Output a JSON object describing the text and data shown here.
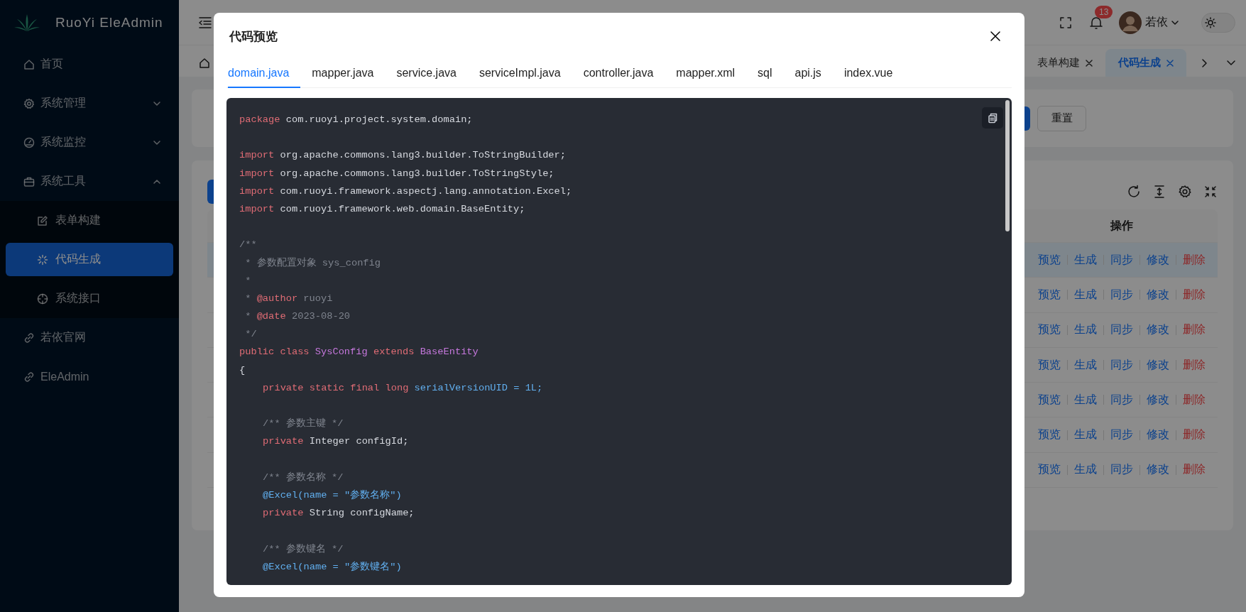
{
  "sidebar": {
    "logo_text": "RuoYi EleAdmin",
    "items": [
      {
        "label": "首页",
        "selected": false
      },
      {
        "label": "系统管理",
        "selected": false,
        "expanded": false
      },
      {
        "label": "系统监控",
        "selected": false,
        "expanded": false
      },
      {
        "label": "系统工具",
        "selected": false,
        "expanded": true,
        "children": [
          {
            "label": "表单构建",
            "selected": false
          },
          {
            "label": "代码生成",
            "selected": true
          },
          {
            "label": "系统接口",
            "selected": false
          }
        ]
      },
      {
        "label": "若依官网",
        "selected": false
      },
      {
        "label": "EleAdmin",
        "selected": false
      }
    ]
  },
  "header": {
    "notification_count": "13",
    "user_name": "若依",
    "dark_mode": false
  },
  "page_tabs": [
    {
      "label": "表单构建",
      "selected": false
    },
    {
      "label": "代码生成",
      "selected": true
    }
  ],
  "search_card": {
    "reset_button": "重置"
  },
  "table": {
    "column_header": "操作",
    "rows": [
      {
        "highlighted": true,
        "actions": [
          {
            "label": "预览",
            "kind": "link"
          },
          {
            "label": "生成",
            "kind": "link"
          },
          {
            "label": "同步",
            "kind": "link"
          },
          {
            "label": "修改",
            "kind": "link"
          },
          {
            "label": "删除",
            "kind": "danger"
          }
        ]
      },
      {
        "highlighted": false,
        "actions": [
          {
            "label": "预览",
            "kind": "link"
          },
          {
            "label": "生成",
            "kind": "link"
          },
          {
            "label": "同步",
            "kind": "link"
          },
          {
            "label": "修改",
            "kind": "link"
          },
          {
            "label": "删除",
            "kind": "danger"
          }
        ]
      },
      {
        "highlighted": false,
        "actions": [
          {
            "label": "预览",
            "kind": "link"
          },
          {
            "label": "生成",
            "kind": "link"
          },
          {
            "label": "同步",
            "kind": "link"
          },
          {
            "label": "修改",
            "kind": "link"
          },
          {
            "label": "删除",
            "kind": "danger"
          }
        ]
      },
      {
        "highlighted": false,
        "actions": [
          {
            "label": "预览",
            "kind": "link"
          },
          {
            "label": "生成",
            "kind": "link"
          },
          {
            "label": "同步",
            "kind": "link"
          },
          {
            "label": "修改",
            "kind": "link"
          },
          {
            "label": "删除",
            "kind": "danger"
          }
        ]
      },
      {
        "highlighted": false,
        "actions": [
          {
            "label": "预览",
            "kind": "link"
          },
          {
            "label": "生成",
            "kind": "link"
          },
          {
            "label": "同步",
            "kind": "link"
          },
          {
            "label": "修改",
            "kind": "link"
          },
          {
            "label": "删除",
            "kind": "danger"
          }
        ]
      },
      {
        "highlighted": false,
        "actions": [
          {
            "label": "预览",
            "kind": "link"
          },
          {
            "label": "生成",
            "kind": "link"
          },
          {
            "label": "同步",
            "kind": "link"
          },
          {
            "label": "修改",
            "kind": "link"
          },
          {
            "label": "删除",
            "kind": "danger"
          }
        ]
      },
      {
        "highlighted": false,
        "actions": [
          {
            "label": "预览",
            "kind": "link"
          },
          {
            "label": "生成",
            "kind": "link"
          },
          {
            "label": "同步",
            "kind": "link"
          },
          {
            "label": "修改",
            "kind": "link"
          },
          {
            "label": "删除",
            "kind": "danger"
          }
        ]
      }
    ]
  },
  "dialog": {
    "title": "代码预览",
    "tabs": [
      {
        "label": "domain.java",
        "selected": true
      },
      {
        "label": "mapper.java",
        "selected": false
      },
      {
        "label": "service.java",
        "selected": false
      },
      {
        "label": "serviceImpl.java",
        "selected": false
      },
      {
        "label": "controller.java",
        "selected": false
      },
      {
        "label": "mapper.xml",
        "selected": false
      },
      {
        "label": "sql",
        "selected": false
      },
      {
        "label": "api.js",
        "selected": false
      },
      {
        "label": "index.vue",
        "selected": false
      }
    ],
    "code_lines": [
      {
        "kind": "code",
        "tokens": [
          {
            "kind": "keyword",
            "text": "package"
          },
          {
            "kind": "plain",
            "text": " com.ruoyi.project.system.domain;"
          }
        ]
      },
      {
        "kind": "blank"
      },
      {
        "kind": "code",
        "tokens": [
          {
            "kind": "keyword",
            "text": "import"
          },
          {
            "kind": "plain",
            "text": " org.apache.commons.lang3.builder.ToStringBuilder;"
          }
        ]
      },
      {
        "kind": "code",
        "tokens": [
          {
            "kind": "keyword",
            "text": "import"
          },
          {
            "kind": "plain",
            "text": " org.apache.commons.lang3.builder.ToStringStyle;"
          }
        ]
      },
      {
        "kind": "code",
        "tokens": [
          {
            "kind": "keyword",
            "text": "import"
          },
          {
            "kind": "plain",
            "text": " com.ruoyi.framework.aspectj.lang.annotation.Excel;"
          }
        ]
      },
      {
        "kind": "code",
        "tokens": [
          {
            "kind": "keyword",
            "text": "import"
          },
          {
            "kind": "plain",
            "text": " com.ruoyi.framework.web.domain.BaseEntity;"
          }
        ]
      },
      {
        "kind": "blank"
      },
      {
        "kind": "code",
        "tokens": [
          {
            "kind": "comment",
            "text": "/**"
          }
        ]
      },
      {
        "kind": "code",
        "tokens": [
          {
            "kind": "comment",
            "text": " * 参数配置对象 sys_config"
          }
        ]
      },
      {
        "kind": "code",
        "tokens": [
          {
            "kind": "comment",
            "text": " *"
          }
        ]
      },
      {
        "kind": "code",
        "tokens": [
          {
            "kind": "comment",
            "text": " * "
          },
          {
            "kind": "doc_tag",
            "text": "@author"
          },
          {
            "kind": "comment",
            "text": " ruoyi"
          }
        ]
      },
      {
        "kind": "code",
        "tokens": [
          {
            "kind": "comment",
            "text": " * "
          },
          {
            "kind": "doc_tag",
            "text": "@date"
          },
          {
            "kind": "comment",
            "text": " 2023-08-20"
          }
        ]
      },
      {
        "kind": "code",
        "tokens": [
          {
            "kind": "comment",
            "text": " */"
          }
        ]
      },
      {
        "kind": "code",
        "tokens": [
          {
            "kind": "keyword",
            "text": "public class "
          },
          {
            "kind": "type",
            "text": "SysConfig"
          },
          {
            "kind": "keyword",
            "text": " extends "
          },
          {
            "kind": "type",
            "text": "BaseEntity"
          }
        ]
      },
      {
        "kind": "code",
        "tokens": [
          {
            "kind": "plain",
            "text": "{"
          }
        ]
      },
      {
        "kind": "code",
        "indented": true,
        "tokens": [
          {
            "kind": "keyword",
            "text": "private static final long "
          },
          {
            "kind": "attribute",
            "text": "serialVersionUID = 1L;"
          }
        ]
      },
      {
        "kind": "blank"
      },
      {
        "kind": "code",
        "indented": true,
        "tokens": [
          {
            "kind": "comment",
            "text": "/** 参数主键 */"
          }
        ]
      },
      {
        "kind": "code",
        "indented": true,
        "tokens": [
          {
            "kind": "keyword",
            "text": "private "
          },
          {
            "kind": "plain",
            "text": "Integer configId;"
          }
        ]
      },
      {
        "kind": "blank"
      },
      {
        "kind": "code",
        "indented": true,
        "tokens": [
          {
            "kind": "comment",
            "text": "/** 参数名称 */"
          }
        ]
      },
      {
        "kind": "code",
        "indented": true,
        "tokens": [
          {
            "kind": "attribute",
            "text": "@Excel(name = \"参数名称\")"
          }
        ]
      },
      {
        "kind": "code",
        "indented": true,
        "tokens": [
          {
            "kind": "keyword",
            "text": "private "
          },
          {
            "kind": "plain",
            "text": "String configName;"
          }
        ]
      },
      {
        "kind": "blank"
      },
      {
        "kind": "code",
        "indented": true,
        "tokens": [
          {
            "kind": "comment",
            "text": "/** 参数键名 */"
          }
        ]
      },
      {
        "kind": "code",
        "indented": true,
        "tokens": [
          {
            "kind": "attribute",
            "text": "@Excel(name = \"参数键名\")"
          }
        ]
      }
    ]
  }
}
